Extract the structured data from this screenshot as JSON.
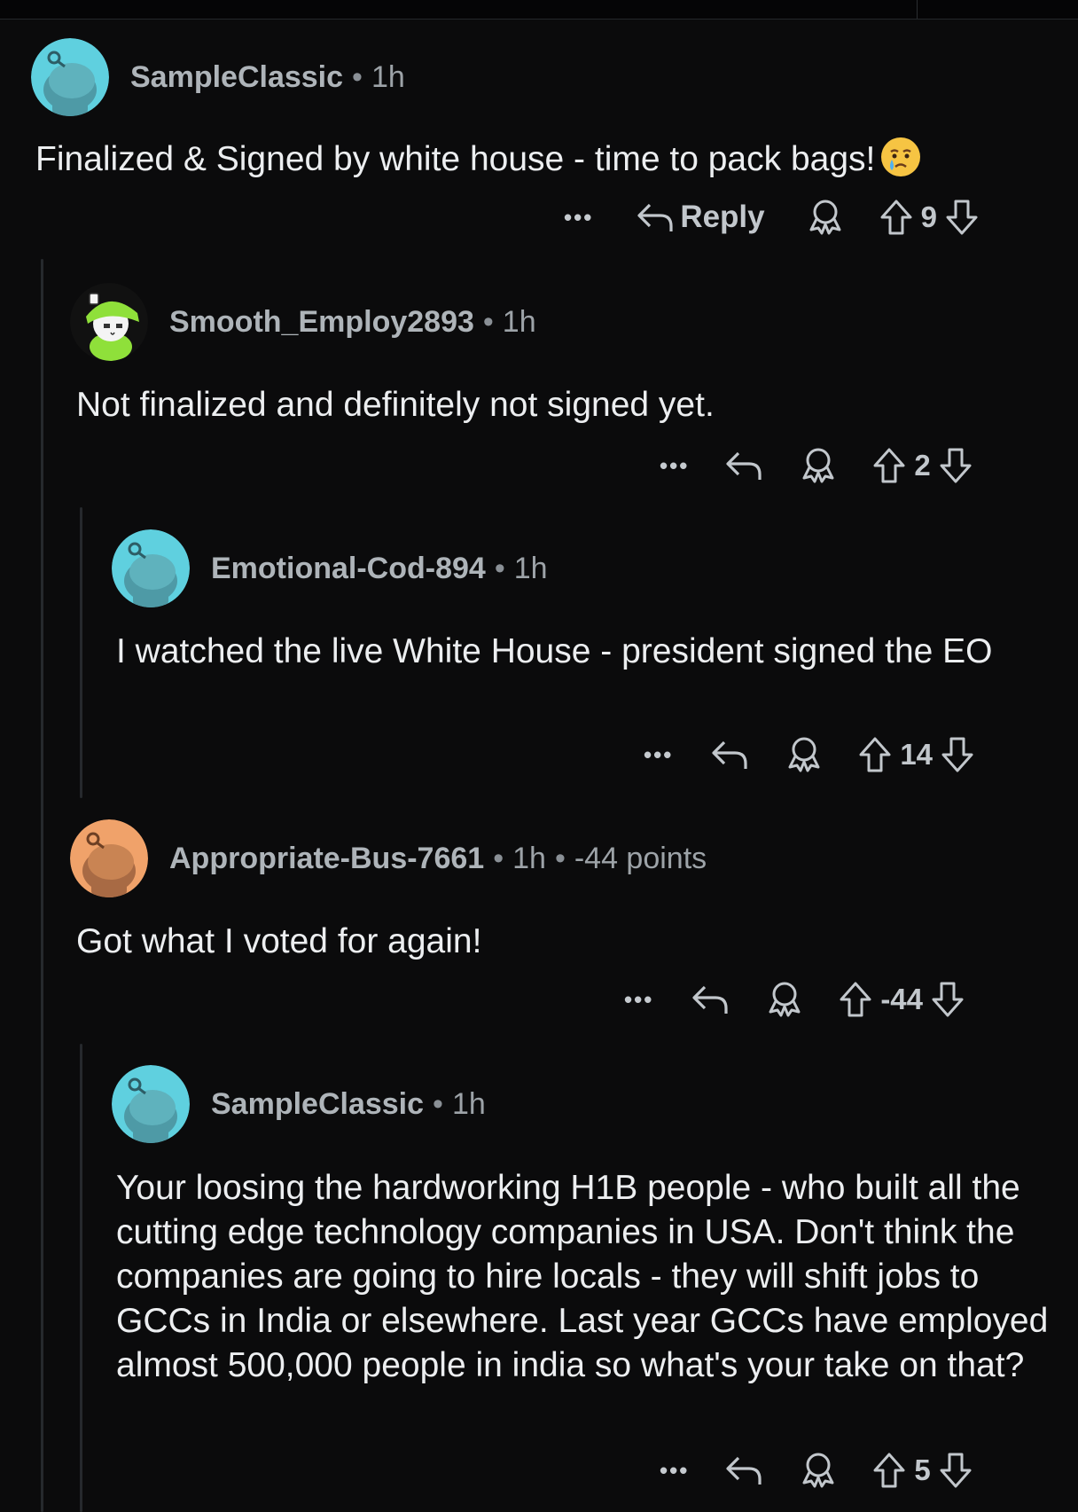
{
  "comments": [
    {
      "username": "SampleClassic",
      "time": "1h",
      "text": "Finalized & Signed by white house - time to pack bags!",
      "emoji": "crying-face",
      "reply_label": "Reply",
      "score": "9",
      "avatar_color": "#5fd0df",
      "avatar_icon": "snoo-avatar-icon"
    },
    {
      "username": "Smooth_Employ2893",
      "time": "1h",
      "text": "Not finalized and definitely not signed yet.",
      "score": "2",
      "avatar_color": "#000000",
      "avatar_icon": "custom-snoo-avatar-icon"
    },
    {
      "username": "Emotional-Cod-894",
      "time": "1h",
      "text": "I watched the live White House - president signed the EO",
      "score": "14",
      "avatar_color": "#5fd0df",
      "avatar_icon": "snoo-avatar-icon"
    },
    {
      "username": "Appropriate-Bus-7661",
      "time": "1h",
      "points": "-44 points",
      "text": "Got what I voted for again!",
      "score": "-44",
      "avatar_color": "#f0a26a",
      "avatar_icon": "snoo-avatar-icon"
    },
    {
      "username": "SampleClassic",
      "time": "1h",
      "text": "Your loosing the hardworking H1B people - who built all the cutting edge technology companies in USA. Don't think the companies are going to hire locals - they will shift jobs to GCCs in India or elsewhere. Last year GCCs have employed almost 500,000 people in india so what's your take on that?",
      "score": "5",
      "avatar_color": "#5fd0df",
      "avatar_icon": "snoo-avatar-icon"
    }
  ],
  "colors": {
    "background": "#0b0b0c",
    "text": "#eceef0",
    "meta": "#9da3a8",
    "thread_line": "#26292d"
  }
}
